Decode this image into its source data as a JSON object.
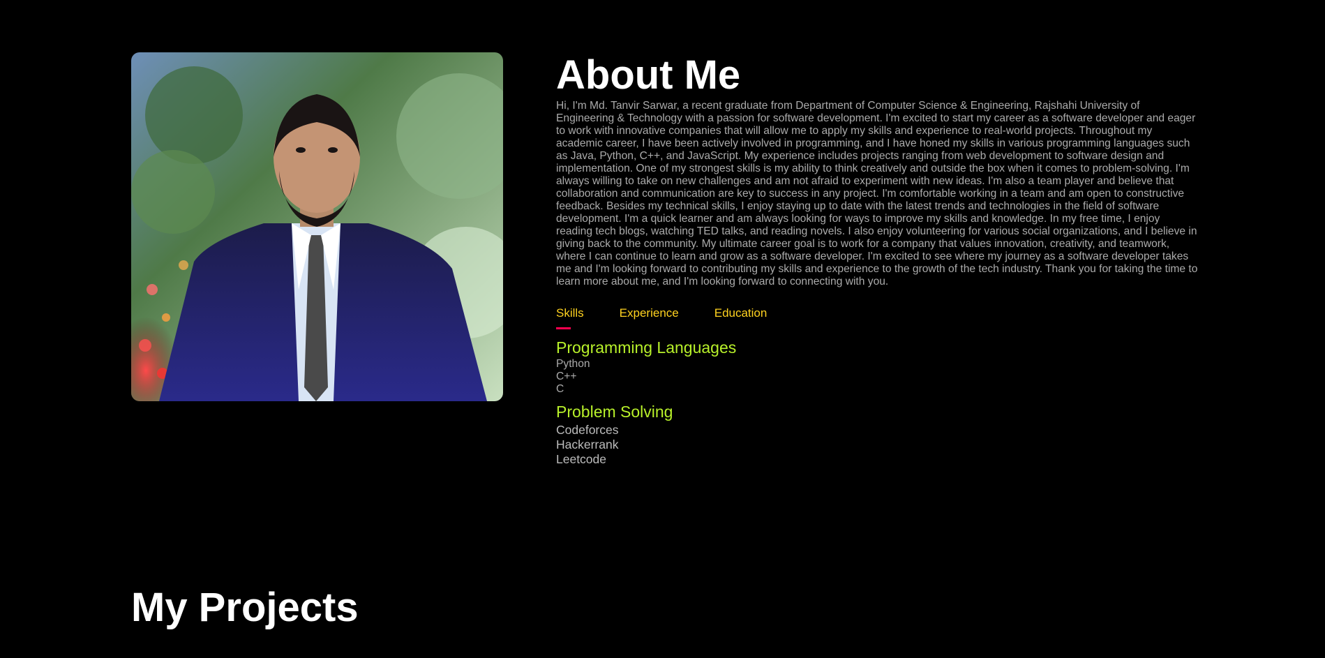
{
  "about": {
    "title": "About Me",
    "bio": "Hi, I'm Md. Tanvir Sarwar, a recent graduate from Department of Computer Science & Engineering, Rajshahi University of Engineering & Technology with a passion for software development. I'm excited to start my career as a software developer and eager to work with innovative companies that will allow me to apply my skills and experience to real-world projects. Throughout my academic career, I have been actively involved in programming, and I have honed my skills in various programming languages such as Java, Python, C++, and JavaScript. My experience includes projects ranging from web development to software design and implementation. One of my strongest skills is my ability to think creatively and outside the box when it comes to problem-solving. I'm always willing to take on new challenges and am not afraid to experiment with new ideas. I'm also a team player and believe that collaboration and communication are key to success in any project. I'm comfortable working in a team and am open to constructive feedback. Besides my technical skills, I enjoy staying up to date with the latest trends and technologies in the field of software development. I'm a quick learner and am always looking for ways to improve my skills and knowledge. In my free time, I enjoy reading tech blogs, watching TED talks, and reading novels. I also enjoy volunteering for various social organizations, and I believe in giving back to the community. My ultimate career goal is to work for a company that values innovation, creativity, and teamwork, where I can continue to learn and grow as a software developer. I'm excited to see where my journey as a software developer takes me and I'm looking forward to contributing my skills and experience to the growth of the tech industry. Thank you for taking the time to learn more about me, and I'm looking forward to connecting with you.",
    "tabs": [
      {
        "label": "Skills",
        "active": true
      },
      {
        "label": "Experience",
        "active": false
      },
      {
        "label": "Education",
        "active": false
      }
    ],
    "skills": {
      "programming_title": "Programming Languages",
      "programming_items": [
        "Python",
        "C++",
        "C"
      ],
      "problem_solving_title": "Problem Solving",
      "problem_solving_items": [
        "Codeforces",
        "Hackerrank",
        "Leetcode"
      ]
    }
  },
  "projects": {
    "title": "My Projects"
  },
  "colors": {
    "background": "#000000",
    "heading": "#ffffff",
    "body_text": "#ababab",
    "tab_text": "#ffd21f",
    "tab_underline": "#ff004f",
    "skill_heading": "#b8f12a"
  },
  "icons": {
    "profile_photo": "person-in-suit-photo"
  }
}
